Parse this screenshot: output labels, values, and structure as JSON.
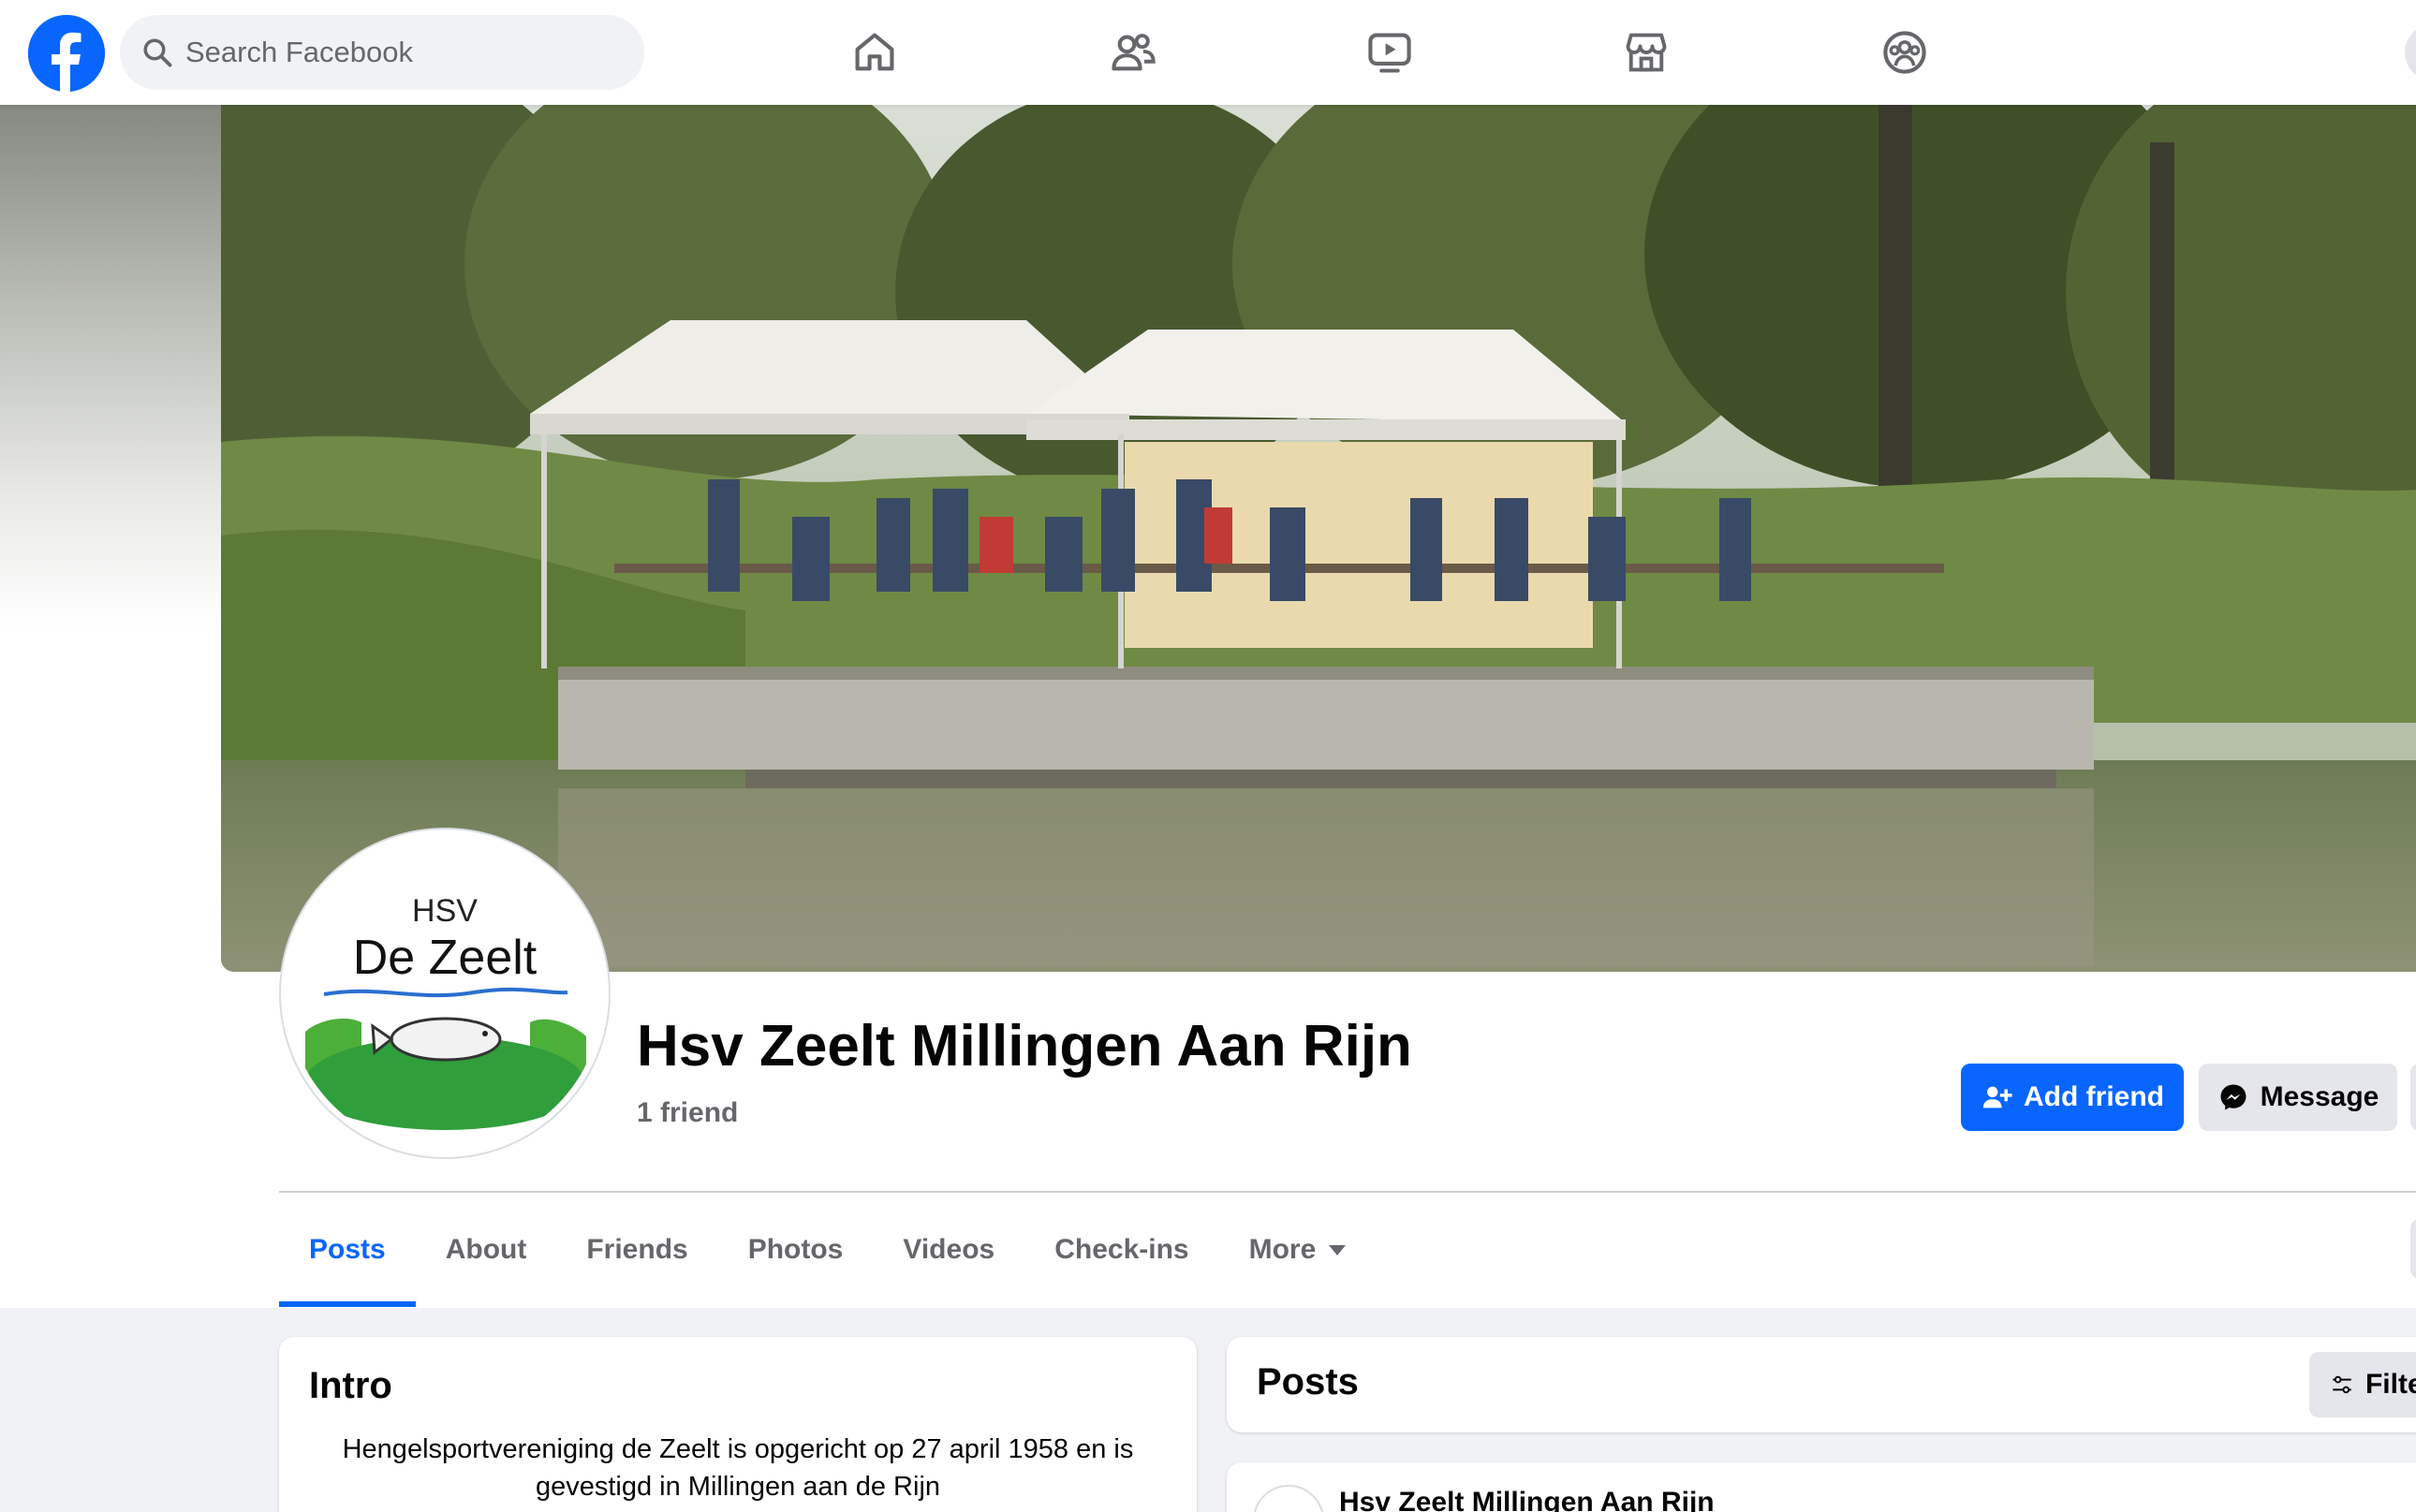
{
  "topbar": {
    "search_placeholder": "Search Facebook",
    "nav_icons": [
      "home-icon",
      "friends-icon",
      "video-icon",
      "marketplace-icon",
      "groups-icon"
    ]
  },
  "profile": {
    "name": "Hsv Zeelt Millingen Aan Rijn",
    "friends": "1 friend",
    "avatar_logo": {
      "line1": "HSV",
      "line2": "De Zeelt"
    }
  },
  "actions": {
    "add_friend": "Add friend",
    "message": "Message"
  },
  "tabs": [
    "Posts",
    "About",
    "Friends",
    "Photos",
    "Videos",
    "Check-ins",
    "More"
  ],
  "active_tab": "Posts",
  "intro": {
    "title": "Intro",
    "text": "Hengelsportvereniging de Zeelt is opgericht op 27 april 1958 en is gevestigd in Millingen aan de Rijn"
  },
  "posts": {
    "title": "Posts",
    "filter_label": "Filters",
    "first_post_author": "Hsv Zeelt Millingen Aan Rijn"
  },
  "colors": {
    "brand_blue": "#0866ff",
    "page_background": "#f0f2f5",
    "secondary_button": "#e4e6eb",
    "muted_text": "#65676b"
  }
}
